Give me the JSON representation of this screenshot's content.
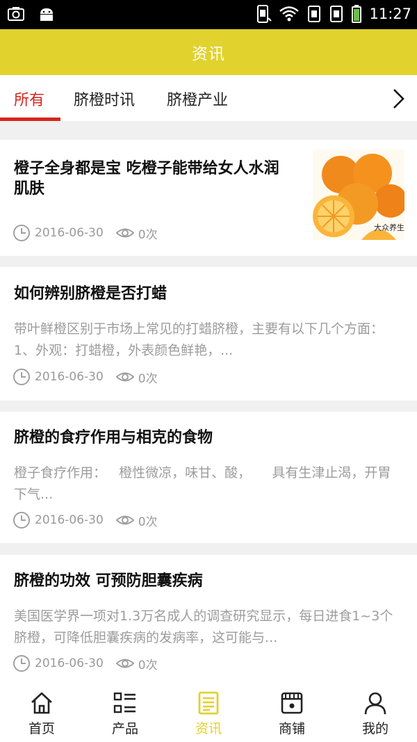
{
  "status_bar": {
    "time": "11:27"
  },
  "header": {
    "title": "资讯"
  },
  "tabs": [
    {
      "label": "所有"
    },
    {
      "label": "脐橙时讯"
    },
    {
      "label": "脐橙产业"
    }
  ],
  "articles": [
    {
      "title": "橙子全身都是宝 吃橙子能带给女人水润肌肤",
      "date": "2016-06-30",
      "views": "0次",
      "image": "oranges-photo"
    },
    {
      "title": "如何辨别脐橙是否打蜡",
      "desc": "带叶鲜橙区别于市场上常见的打蜡脐橙，主要有以下几个方面：1、外观：打蜡橙，外表颜色鲜艳，...",
      "date": "2016-06-30",
      "views": "0次"
    },
    {
      "title": "脐橙的食疗作用与相克的食物",
      "desc": "橙子食疗作用：   橙性微凉，味甘、酸，     具有生津止渴，开胃下气...",
      "date": "2016-06-30",
      "views": "0次"
    },
    {
      "title": "脐橙的功效 可预防胆囊疾病",
      "desc": "美国医学界一项对1.3万名成人的调查研究显示，每日进食1~3个脐橙，可降低胆囊疾病的发病率，这可能与...",
      "date": "2016-06-30",
      "views": "0次"
    }
  ],
  "bottom_nav": [
    {
      "label": "首页",
      "icon": "home-icon"
    },
    {
      "label": "产品",
      "icon": "list-icon"
    },
    {
      "label": "资讯",
      "icon": "news-icon",
      "active": true
    },
    {
      "label": "商铺",
      "icon": "shop-icon"
    },
    {
      "label": "我的",
      "icon": "user-icon"
    }
  ],
  "colors": {
    "header": "#e1d22e",
    "active_tab": "#d6261e",
    "muted_text": "#9c9c9c"
  }
}
